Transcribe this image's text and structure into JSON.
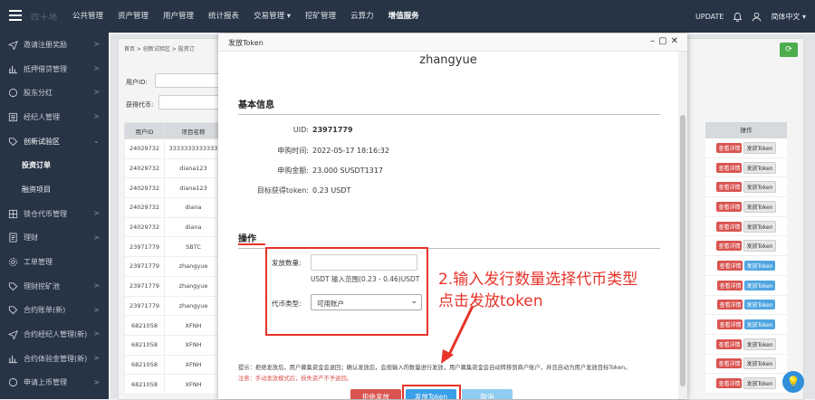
{
  "topbar": {
    "brand": "四十地",
    "nav": [
      "公共管理",
      "资产管理",
      "用户管理",
      "统计报表",
      "交易管理 ▾",
      "挖矿管理",
      "云算力",
      "增值服务"
    ],
    "active_index": 7,
    "update_label": "UPDATE",
    "lang_label": "简体中文 ▾"
  },
  "sidebar": {
    "items": [
      {
        "label": "邀请注册奖励",
        "icon": "send-icon",
        "arrow": ">"
      },
      {
        "label": "抵押借贷管理",
        "icon": "bar-chart-icon",
        "arrow": ">"
      },
      {
        "label": "股东分红",
        "icon": "circle-icon",
        "arrow": ">"
      },
      {
        "label": "经纪人管理",
        "icon": "list-icon",
        "arrow": ">"
      },
      {
        "label": "创新试验区",
        "icon": "tag-icon",
        "arrow": "⌄"
      },
      {
        "label": "投资订单",
        "icon": "",
        "arrow": ""
      },
      {
        "label": "融资项目",
        "icon": "",
        "arrow": ""
      },
      {
        "label": "锁仓代币管理",
        "icon": "grid-icon",
        "arrow": ">"
      },
      {
        "label": "理财",
        "icon": "doc-icon",
        "arrow": ">"
      },
      {
        "label": "工单管理",
        "icon": "gear-icon",
        "arrow": ""
      },
      {
        "label": "理财挖矿池",
        "icon": "tag-icon",
        "arrow": ">"
      },
      {
        "label": "合约账单(新)",
        "icon": "tag-icon",
        "arrow": ">"
      },
      {
        "label": "合约经纪人管理(新)",
        "icon": "send-icon",
        "arrow": ">"
      },
      {
        "label": "合约体验金管理(新)",
        "icon": "bar-chart-icon",
        "arrow": ">"
      },
      {
        "label": "申请上币管理",
        "icon": "circle-icon",
        "arrow": ">"
      }
    ]
  },
  "background": {
    "breadcrumb": "首页 > 创新试验区 > 投资订",
    "user_id_label": "用户ID:",
    "token_label": "获得代币:",
    "columns": [
      "用户ID",
      "项目名称"
    ],
    "action_header": "操作",
    "rows": [
      [
        "24029732",
        "3333333333333"
      ],
      [
        "24029732",
        "diana123"
      ],
      [
        "24029732",
        "diana123"
      ],
      [
        "24029732",
        "diana"
      ],
      [
        "24029732",
        "diana"
      ],
      [
        "23971779",
        "SBTC"
      ],
      [
        "23971779",
        "zhangyue"
      ],
      [
        "23971779",
        "zhangyue"
      ],
      [
        "23971779",
        "zhangyue"
      ],
      [
        "6821058",
        "XFNH"
      ],
      [
        "6821058",
        "XFNH"
      ],
      [
        "6821058",
        "XFNH"
      ],
      [
        "6821058",
        "XFNH"
      ]
    ],
    "action_detail": "查看详情",
    "action_issue": "发放Token",
    "action_issue_highlighted_rows": [
      6,
      7,
      8,
      9
    ]
  },
  "modal": {
    "title": "发放Token",
    "name": "zhangyue",
    "basic_section": "基本信息",
    "fields": [
      {
        "label": "UID:",
        "value": "23971779"
      },
      {
        "label": "申购时间:",
        "value": "2022-05-17 18:16:32"
      },
      {
        "label": "申购金额:",
        "value": "23.000 SUSDT1317"
      },
      {
        "label": "目标获得token:",
        "value": "0.23 USDT"
      }
    ],
    "ops_section": "操作",
    "amount_label": "发放数量:",
    "amount_value": "",
    "amount_hint": "USDT  输入范围(0.23 - 0.46)USDT",
    "coin_type_label": "代币类型:",
    "coin_type_selected": "可用账户",
    "tip": "提示：拒绝发放后，用户募集资金会退回；确认发放后，会按输入的数量进行发放，用户募集资金会自动转移到商户账户，并且自动为用户发放目标Token。",
    "warning": "注意：手动发放模式后，损失资产不予退回。",
    "reject_button": "拒绝发放",
    "issue_button": "发放Token",
    "cancel_button": "取消"
  },
  "annotation": {
    "line1": "2.输入发行数量选择代币类型",
    "line2": "点击发放token",
    "color": "#e8332a"
  }
}
